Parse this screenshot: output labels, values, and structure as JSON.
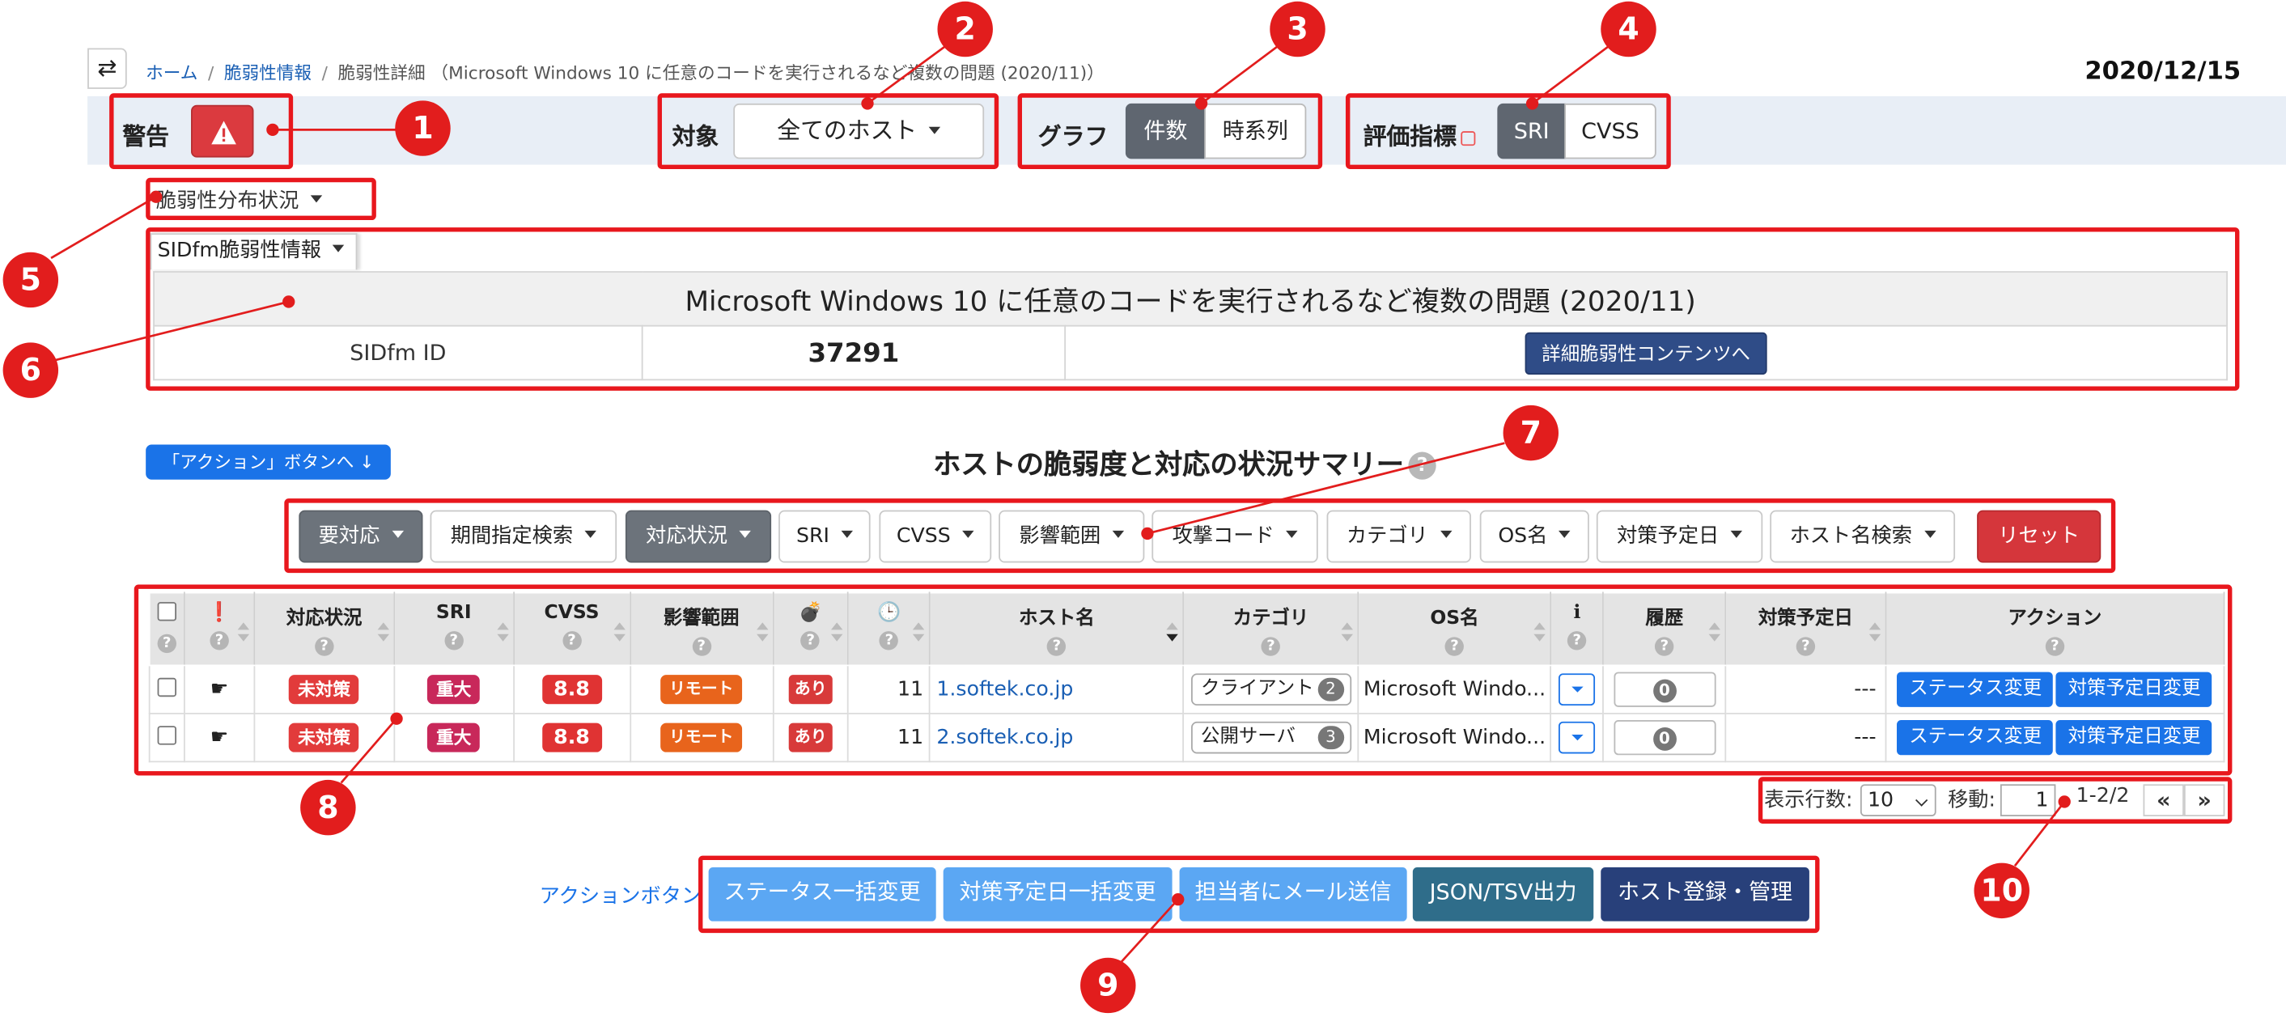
{
  "breadcrumb": {
    "home": "ホーム",
    "vuln_info": "脆弱性情報",
    "current": "脆弱性詳細 （Microsoft Windows 10 に任意のコードを実行されるなど複数の問題 (2020/11)）"
  },
  "date": "2020/12/15",
  "toolbar": {
    "warning_label": "警告",
    "target_label": "対象",
    "target_value": "全てのホスト",
    "graph_label": "グラフ",
    "graph_count": "件数",
    "graph_timeseries": "時系列",
    "metric_label": "評価指標",
    "metric_sri": "SRI",
    "metric_cvss": "CVSS"
  },
  "distribution_dropdown": "脆弱性分布状況",
  "sidfm_tab": "SIDfm脆弱性情報",
  "info": {
    "title": "Microsoft Windows 10 に任意のコードを実行されるなど複数の問題 (2020/11)",
    "id_label": "SIDfm ID",
    "id_value": "37291",
    "detail_button": "詳細脆弱性コンテンツへ"
  },
  "action_link": "「アクション」ボタンへ ↓",
  "summary_title": "ホストの脆弱度と対応の状況サマリー",
  "help_mark": "?",
  "filters": [
    "要対応",
    "期間指定検索",
    "対応状況",
    "SRI",
    "CVSS",
    "影響範囲",
    "攻撃コード",
    "カテゴリ",
    "OS名",
    "対策予定日",
    "ホスト名検索"
  ],
  "reset_label": "リセット",
  "table": {
    "headers": [
      "対応状況",
      "SRI",
      "CVSS",
      "影響範囲",
      "ホスト名",
      "カテゴリ",
      "OS名",
      "履歴",
      "対策予定日",
      "アクション"
    ],
    "rows": [
      {
        "status": "未対策",
        "sri": "重大",
        "cvss": "8.8",
        "scope": "リモート",
        "exploit": "あり",
        "days": "11",
        "host": "1.softek.co.jp",
        "category": "クライアント",
        "cat_count": "2",
        "os": "Microsoft Windo...",
        "history": "0",
        "plan_date": "---",
        "btn_status": "ステータス変更",
        "btn_plan": "対策予定日変更"
      },
      {
        "status": "未対策",
        "sri": "重大",
        "cvss": "8.8",
        "scope": "リモート",
        "exploit": "あり",
        "days": "11",
        "host": "2.softek.co.jp",
        "category": "公開サーバ",
        "cat_count": "3",
        "os": "Microsoft Windo...",
        "history": "0",
        "plan_date": "---",
        "btn_status": "ステータス変更",
        "btn_plan": "対策予定日変更"
      }
    ]
  },
  "pager": {
    "rows_label": "表示行数:",
    "rows_value": "10",
    "move_label": "移動:",
    "page_value": "1",
    "range": "1-2/2",
    "prev": "«",
    "next": "»"
  },
  "actions": {
    "label": "アクションボタン",
    "bulk_status": "ステータス一括変更",
    "bulk_plan": "対策予定日一括変更",
    "send_mail": "担当者にメール送信",
    "export": "JSON/TSV出力",
    "host_mgmt": "ホスト登録・管理"
  },
  "callouts": [
    "1",
    "2",
    "3",
    "4",
    "5",
    "6",
    "7",
    "8",
    "9",
    "10"
  ],
  "colors": {
    "callout": "#e21d1d",
    "primary": "#1a73e8",
    "danger": "#db3a3f",
    "navy": "#2f4c87"
  }
}
